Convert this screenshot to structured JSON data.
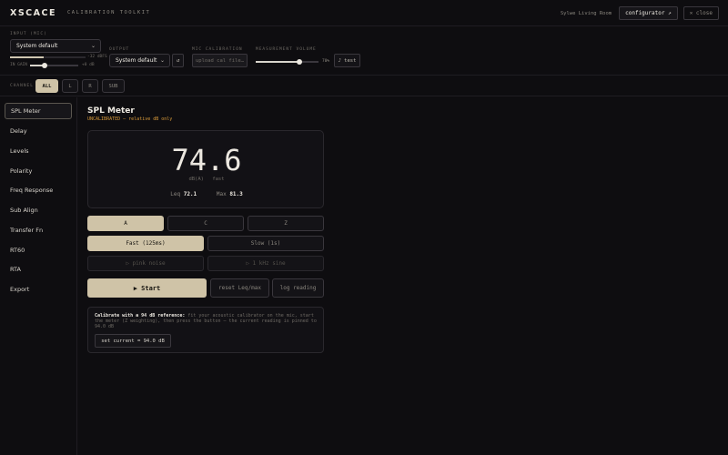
{
  "header": {
    "logo": "XSCACE",
    "subtitle": "CALIBRATION TOOLKIT",
    "room": "Sylwe Living Room",
    "configurator_label": "configurator ↗",
    "close_label": "✕ close"
  },
  "io": {
    "input_label": "INPUT (MIC)",
    "input_value": "System default",
    "input_level_fraction": 0.45,
    "input_peak": "-32 dBFS",
    "input_gain_left": "IN GAIN",
    "input_gain_right": "+0 dB",
    "input_gain_fraction": 0.3,
    "output_label": "OUTPUT",
    "output_value": "System default",
    "refresh_glyph": "↺",
    "mic_cal_label": "MIC CALIBRATION",
    "mic_cal_button": "upload cal file…",
    "volume_label": "MEASUREMENT VOLUME",
    "volume_value": "70%",
    "volume_fraction": 0.7,
    "test_button": "♪ test"
  },
  "channels": {
    "label": "CHANNEL",
    "items": [
      "ALL",
      "L",
      "R",
      "SUB"
    ],
    "active": "ALL"
  },
  "sidebar": {
    "items": [
      "SPL Meter",
      "Delay",
      "Levels",
      "Polarity",
      "Freq Response",
      "Sub Align",
      "Transfer Fn",
      "RT60",
      "RTA",
      "Export"
    ],
    "active": "SPL Meter"
  },
  "main": {
    "title": "SPL Meter",
    "status": "UNCALIBRATED — relative dB only",
    "reading": "74.6",
    "unit": "dB(A)",
    "speed": "fast",
    "leq_label": "Leq",
    "leq_value": "72.1",
    "max_label": "Max",
    "max_value": "81.3",
    "weighting": [
      "A",
      "C",
      "Z"
    ],
    "weighting_active": "A",
    "response": [
      "Fast (125ms)",
      "Slow (1s)"
    ],
    "response_active": "Fast (125ms)",
    "signals": [
      "▷ pink noise",
      "▷ 1 kHz sine"
    ],
    "start_label": "▶ Start",
    "reset_label": "reset Leq/max",
    "log_label": "log reading",
    "calib_bold": "Calibrate with a 94 dB reference:",
    "calib_rest": " fit your acoustic calibrator on the mic, start the meter (Z weighting), then press the button — the current reading is pinned to 94.0 dB",
    "set_label": "set current = 94.0 dB"
  },
  "colors": {
    "background": "#0e0d10",
    "accent": "#cfc3a7",
    "warning": "#d89a3a"
  }
}
